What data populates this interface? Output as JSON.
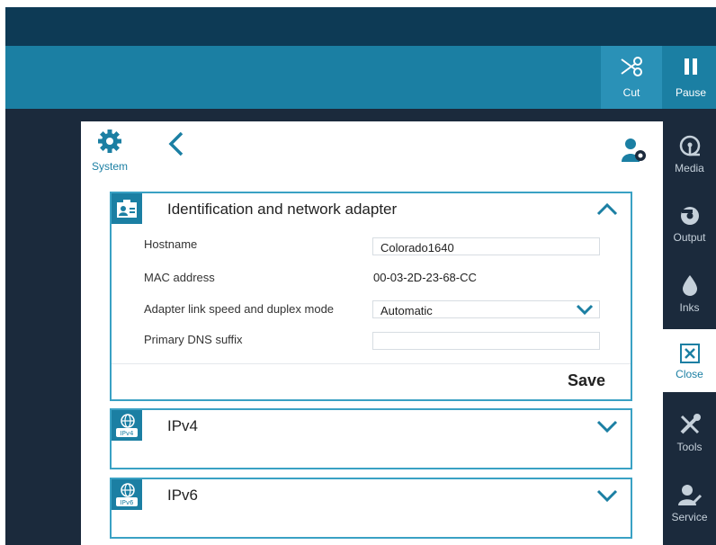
{
  "toolbar": {
    "cut_label": "Cut",
    "pause_label": "Pause"
  },
  "header": {
    "system_label": "System"
  },
  "sidebar": {
    "items": [
      {
        "label": "Media",
        "icon": "media-icon"
      },
      {
        "label": "Output",
        "icon": "output-icon"
      },
      {
        "label": "Inks",
        "icon": "inks-icon"
      },
      {
        "label": "Close",
        "icon": "close-icon"
      },
      {
        "label": "Tools",
        "icon": "tools-icon"
      },
      {
        "label": "Service",
        "icon": "service-icon"
      }
    ]
  },
  "identification": {
    "title": "Identification and network adapter",
    "hostname_label": "Hostname",
    "hostname_value": "Colorado1640",
    "mac_label": "MAC address",
    "mac_value": "00-03-2D-23-68-CC",
    "link_label": "Adapter link speed and duplex mode",
    "link_value": "Automatic",
    "dns_label": "Primary DNS suffix",
    "dns_value": "",
    "save_label": "Save"
  },
  "ipv4": {
    "title": "IPv4",
    "badge": "IPv4"
  },
  "ipv6": {
    "title": "IPv6",
    "badge": "IPv6"
  },
  "colors": {
    "accent": "#1b7fa3",
    "toolbar": "#1b7fa3",
    "topbar": "#0d3a55",
    "background": "#1b2a3c",
    "border": "#3aa1c4"
  }
}
